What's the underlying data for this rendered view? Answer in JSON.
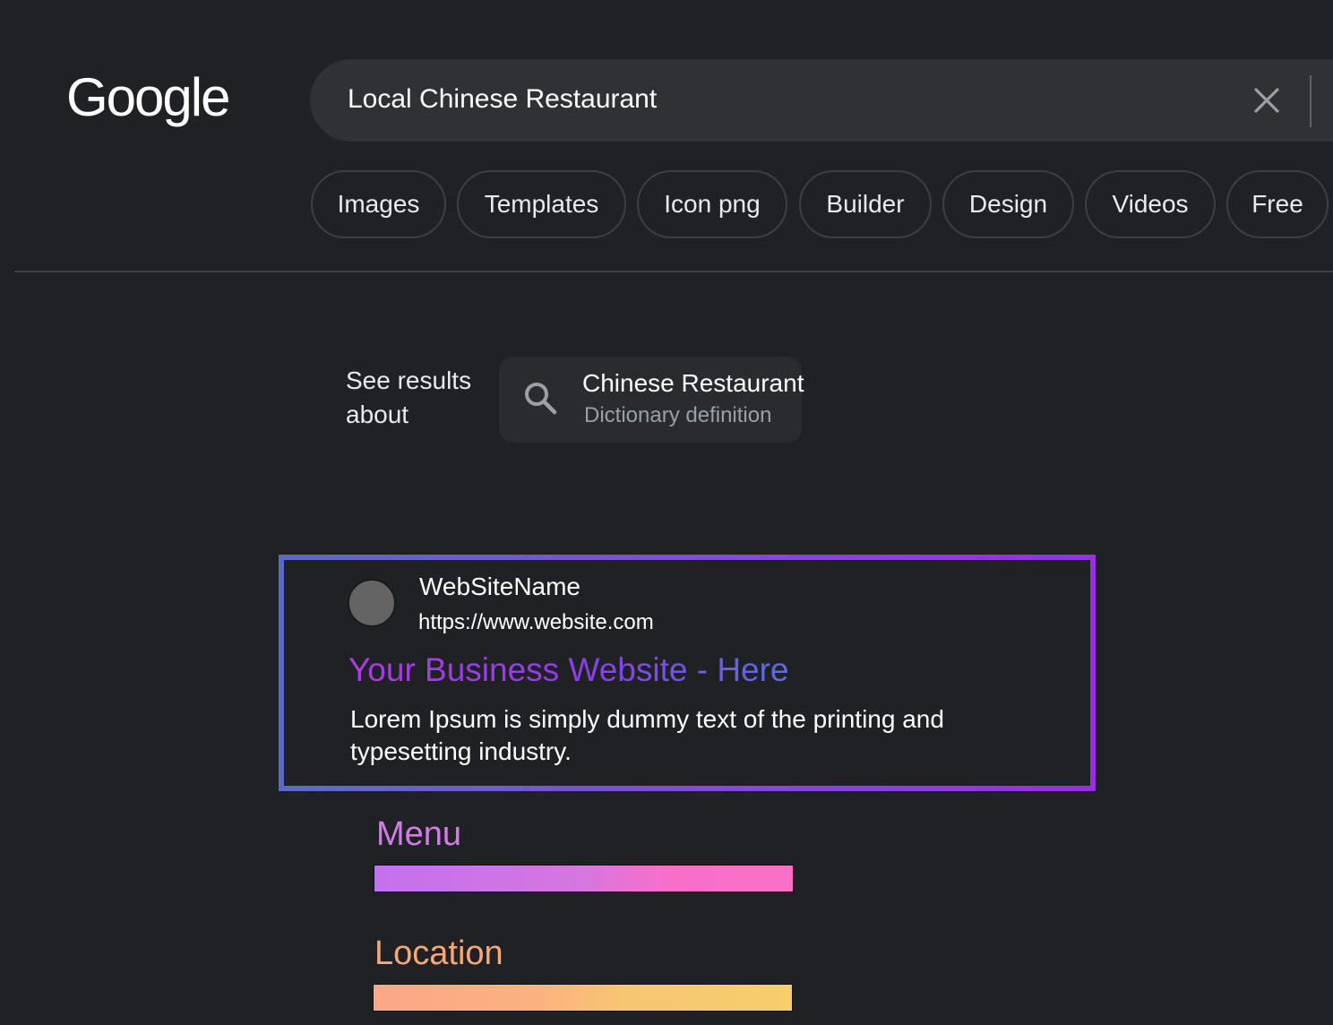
{
  "logo": {
    "text": "Google"
  },
  "search": {
    "query": "Local Chinese Restaurant"
  },
  "chips": [
    "Images",
    "Templates",
    "Icon png",
    "Builder",
    "Design",
    "Videos",
    "Free"
  ],
  "see_results": {
    "label_line1": "See results",
    "label_line2": "about",
    "title": "Chinese Restaurant",
    "subtitle": "Dictionary definition"
  },
  "result": {
    "site_name": "WebSiteName",
    "url": "https://www.website.com",
    "title": "Your Business Website - Here",
    "snippet_line1": "Lorem Ipsum is simply dummy text of the printing and",
    "snippet_line2": "typesetting industry."
  },
  "sections": {
    "menu": "Menu",
    "location": "Location"
  },
  "colors": {
    "background": "#202124",
    "search_bar": "#303134",
    "menu_label": "#d37ce8",
    "location_label": "#f5a878",
    "border_gradient_start": "#5a6bc4",
    "border_gradient_end": "#9a2ee6"
  },
  "icons": {
    "clear": "close-icon",
    "see_results": "search-icon",
    "favicon": "site-favicon"
  }
}
